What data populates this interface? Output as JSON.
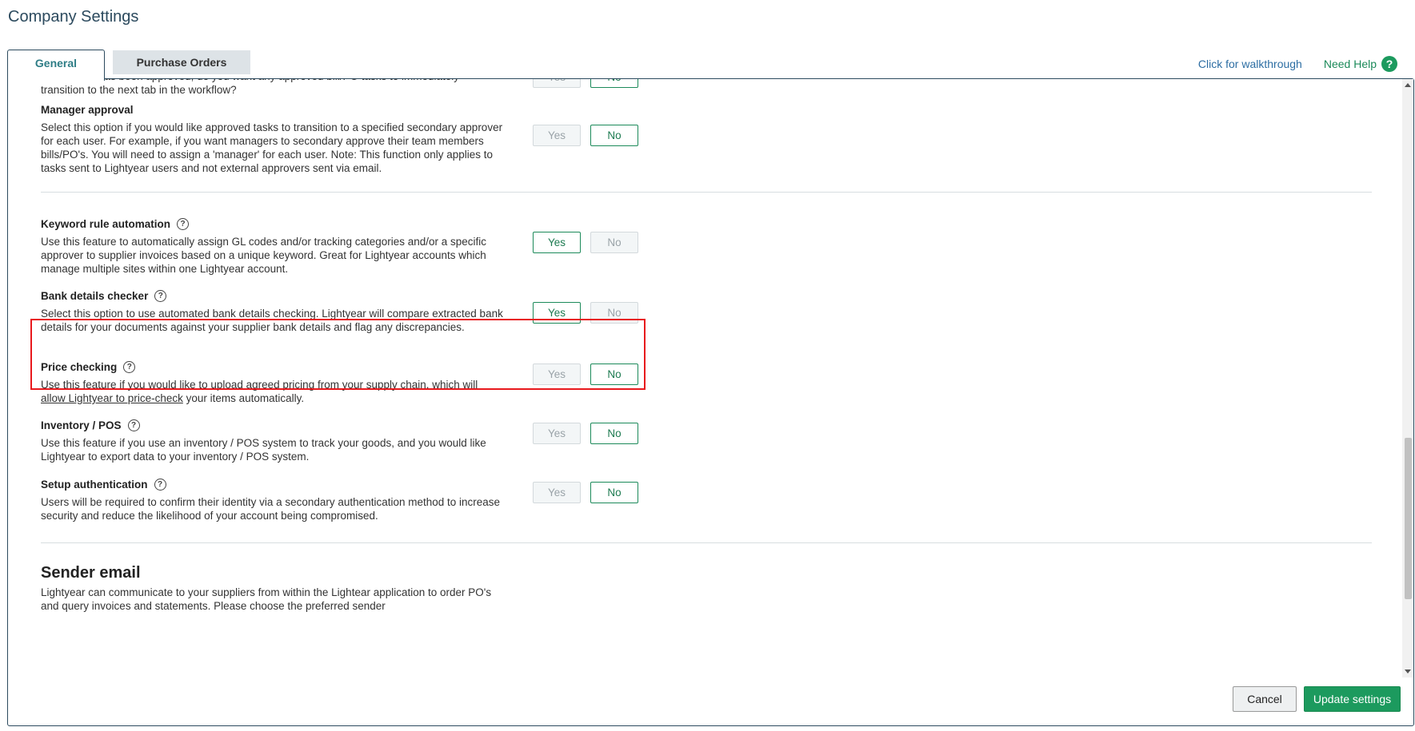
{
  "header": {
    "title": "Company Settings"
  },
  "tabs": [
    {
      "label": "General",
      "active": true
    },
    {
      "label": "Purchase Orders",
      "active": false
    }
  ],
  "links": {
    "walkthrough": "Click for walkthrough",
    "help": "Need Help",
    "help_glyph": "?"
  },
  "settings": {
    "partial": {
      "desc": "After a task has been approved, do you want any approved bill/PO tasks to immediately transition to the next tab in the workflow?",
      "yes": "Yes",
      "no": "No",
      "selected": "No"
    },
    "manager_approval": {
      "title": "Manager approval",
      "desc": "Select this option if you would like approved tasks to transition to a specified secondary approver for each user. For example, if you want managers to secondary approve their team members bills/PO's. You will need to assign a 'manager' for each user. Note: This function only applies to tasks sent to Lightyear users and not external approvers sent via email.",
      "yes": "Yes",
      "no": "No",
      "selected": "No"
    },
    "keyword_rule": {
      "title": "Keyword rule automation",
      "desc": "Use this feature to automatically assign GL codes and/or tracking categories and/or a specific approver to supplier invoices based on a unique keyword. Great for Lightyear accounts which manage multiple sites within one Lightyear account.",
      "yes": "Yes",
      "no": "No",
      "selected": "Yes"
    },
    "bank_details": {
      "title": "Bank details checker",
      "desc": "Select this option to use automated bank details checking. Lightyear will compare extracted bank details for your documents against your supplier bank details and flag any discrepancies.",
      "yes": "Yes",
      "no": "No",
      "selected": "Yes"
    },
    "price_checking": {
      "title": "Price checking",
      "desc_pre": "Use this feature if you would like to upload agreed pricing from your supply chain, ",
      "desc_link": "which will allow Lightyear to price-check",
      "desc_post": " your items automatically.",
      "yes": "Yes",
      "no": "No",
      "selected": "No"
    },
    "inventory_pos": {
      "title": "Inventory / POS",
      "desc": "Use this feature if you use an inventory / POS system to track your goods, and you would like Lightyear to export data to your inventory / POS system.",
      "yes": "Yes",
      "no": "No",
      "selected": "No"
    },
    "setup_auth": {
      "title": "Setup authentication",
      "desc": "Users will be required to confirm their identity via a secondary authentication method to increase security and reduce the likelihood of your account being compromised.",
      "yes": "Yes",
      "no": "No",
      "selected": "No"
    }
  },
  "sender_email": {
    "title": "Sender email",
    "desc": "Lightyear can communicate to your suppliers from within the Lightear application to order PO's and query invoices and statements. Please choose the preferred sender"
  },
  "footer": {
    "cancel": "Cancel",
    "update": "Update settings"
  },
  "colors": {
    "accent": "#1c9a5e",
    "highlight": "#e8191d",
    "link": "#2d6ea3"
  }
}
